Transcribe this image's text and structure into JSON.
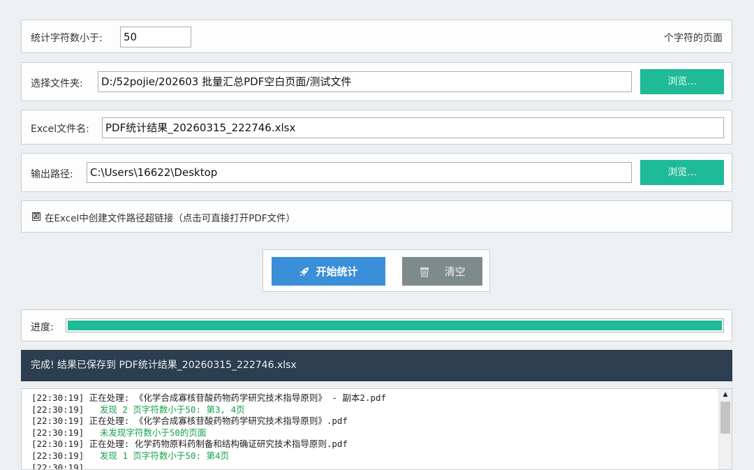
{
  "threshold": {
    "label": "统计字符数小于:",
    "value": "50",
    "suffix": "个字符的页面"
  },
  "folder": {
    "label": "选择文件夹:",
    "value": "D:/52pojie/202603 批量汇总PDF空白页面/测试文件",
    "browse_label": "浏览..."
  },
  "excel": {
    "label": "Excel文件名:",
    "value": "PDF统计结果_20260315_222746.xlsx"
  },
  "output": {
    "label": "输出路径:",
    "value": "C:\\Users\\16622\\Desktop",
    "browse_label": "浏览..."
  },
  "hyperlink_option": {
    "checked_mark": "🗵",
    "label": "在Excel中创建文件路径超链接（点击可直接打开PDF文件）",
    "checked": true
  },
  "actions": {
    "start_label": "开始统计",
    "start_icon": "rocket-icon",
    "clear_label": "清空",
    "clear_icon": "trash-icon"
  },
  "progress": {
    "label": "进度:",
    "percent": 100
  },
  "status": {
    "message": "完成! 结果已保存到 PDF统计结果_20260315_222746.xlsx"
  },
  "log": {
    "lines": [
      {
        "time": "[22:30:19]",
        "text": " 正在处理: 《化学合成寡核苷酸药物药学研究技术指导原则》 - 副本2.pdf",
        "kind": "info"
      },
      {
        "time": "[22:30:19]",
        "text": "   发现 2 页字符数小于50: 第3, 4页",
        "kind": "ok"
      },
      {
        "time": "[22:30:19]",
        "text": " 正在处理: 《化学合成寡核苷酸药物药学研究技术指导原则》.pdf",
        "kind": "info"
      },
      {
        "time": "[22:30:19]",
        "text": "   未发现字符数小于50的页面",
        "kind": "ok"
      },
      {
        "time": "[22:30:19]",
        "text": " 正在处理: 化学药物原料药制备和结构确证研究技术指导原则.pdf",
        "kind": "info"
      },
      {
        "time": "[22:30:19]",
        "text": "   发现 1 页字符数小于50: 第4页",
        "kind": "ok"
      },
      {
        "time": "[22:30:19]",
        "text": "",
        "kind": "info"
      }
    ]
  },
  "colors": {
    "accent_green": "#1fba97",
    "primary_blue": "#3b8fd9",
    "status_bar_bg": "#2c3e50",
    "log_success": "#13a14b"
  }
}
